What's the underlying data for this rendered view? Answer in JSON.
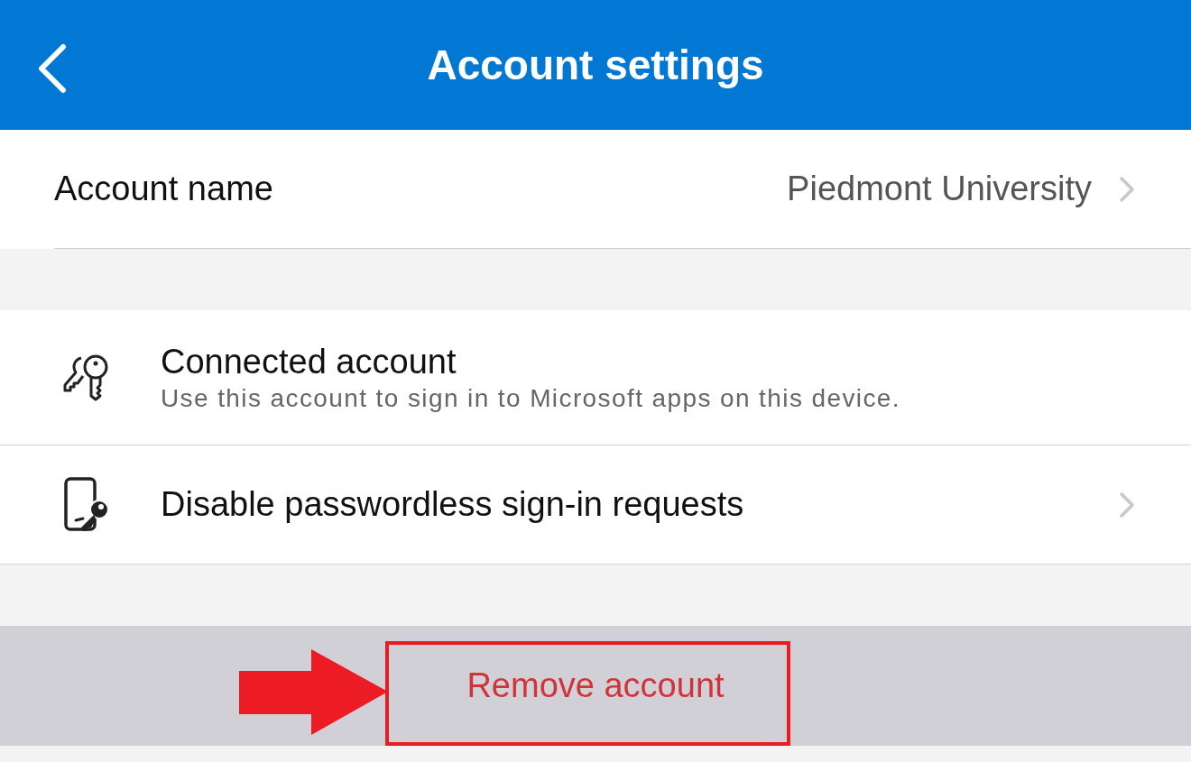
{
  "header": {
    "title": "Account settings"
  },
  "account_name": {
    "label": "Account name",
    "value": "Piedmont University"
  },
  "items": [
    {
      "kind": "account",
      "title": "Connected account",
      "subtitle": "Use this account to sign in to Microsoft apps on this device."
    },
    {
      "kind": "action",
      "title": "Disable passwordless sign-in requests"
    }
  ],
  "remove_button": {
    "label": "Remove account",
    "highlighted": true
  }
}
